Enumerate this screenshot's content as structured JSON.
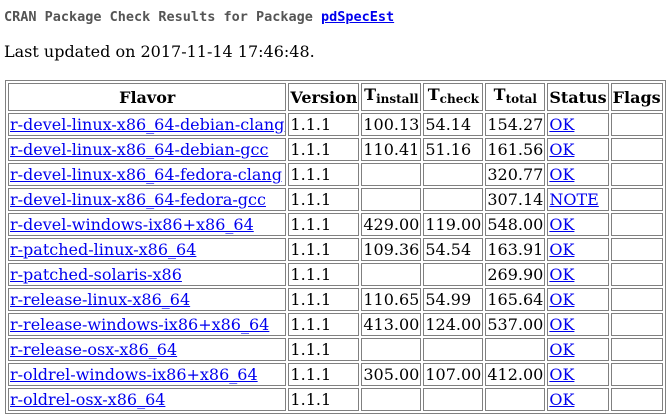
{
  "heading": {
    "prefix": "CRAN Package Check Results for Package ",
    "package": "pdSpecEst"
  },
  "last_updated": "Last updated on 2017-11-14 17:46:48.",
  "table": {
    "headers": {
      "flavor": "Flavor",
      "version": "Version",
      "tinstall_T": "T",
      "tinstall_sub": "install",
      "tcheck_T": "T",
      "tcheck_sub": "check",
      "ttotal_T": "T",
      "ttotal_sub": "total",
      "status": "Status",
      "flags": "Flags"
    },
    "rows": [
      {
        "flavor": "r-devel-linux-x86_64-debian-clang",
        "version": "1.1.1",
        "tinstall": "100.13",
        "tcheck": "54.14",
        "ttotal": "154.27",
        "status": "OK",
        "flags": ""
      },
      {
        "flavor": "r-devel-linux-x86_64-debian-gcc",
        "version": "1.1.1",
        "tinstall": "110.41",
        "tcheck": "51.16",
        "ttotal": "161.56",
        "status": "OK",
        "flags": ""
      },
      {
        "flavor": "r-devel-linux-x86_64-fedora-clang",
        "version": "1.1.1",
        "tinstall": "",
        "tcheck": "",
        "ttotal": "320.77",
        "status": "OK",
        "flags": ""
      },
      {
        "flavor": "r-devel-linux-x86_64-fedora-gcc",
        "version": "1.1.1",
        "tinstall": "",
        "tcheck": "",
        "ttotal": "307.14",
        "status": "NOTE",
        "flags": ""
      },
      {
        "flavor": "r-devel-windows-ix86+x86_64",
        "version": "1.1.1",
        "tinstall": "429.00",
        "tcheck": "119.00",
        "ttotal": "548.00",
        "status": "OK",
        "flags": ""
      },
      {
        "flavor": "r-patched-linux-x86_64",
        "version": "1.1.1",
        "tinstall": "109.36",
        "tcheck": "54.54",
        "ttotal": "163.91",
        "status": "OK",
        "flags": ""
      },
      {
        "flavor": "r-patched-solaris-x86",
        "version": "1.1.1",
        "tinstall": "",
        "tcheck": "",
        "ttotal": "269.90",
        "status": "OK",
        "flags": ""
      },
      {
        "flavor": "r-release-linux-x86_64",
        "version": "1.1.1",
        "tinstall": "110.65",
        "tcheck": "54.99",
        "ttotal": "165.64",
        "status": "OK",
        "flags": ""
      },
      {
        "flavor": "r-release-windows-ix86+x86_64",
        "version": "1.1.1",
        "tinstall": "413.00",
        "tcheck": "124.00",
        "ttotal": "537.00",
        "status": "OK",
        "flags": ""
      },
      {
        "flavor": "r-release-osx-x86_64",
        "version": "1.1.1",
        "tinstall": "",
        "tcheck": "",
        "ttotal": "",
        "status": "OK",
        "flags": ""
      },
      {
        "flavor": "r-oldrel-windows-ix86+x86_64",
        "version": "1.1.1",
        "tinstall": "305.00",
        "tcheck": "107.00",
        "ttotal": "412.00",
        "status": "OK",
        "flags": ""
      },
      {
        "flavor": "r-oldrel-osx-x86_64",
        "version": "1.1.1",
        "tinstall": "",
        "tcheck": "",
        "ttotal": "",
        "status": "OK",
        "flags": ""
      }
    ]
  },
  "colors": {
    "link": "#0000ee",
    "heading_text": "#555555",
    "border": "#808080"
  }
}
